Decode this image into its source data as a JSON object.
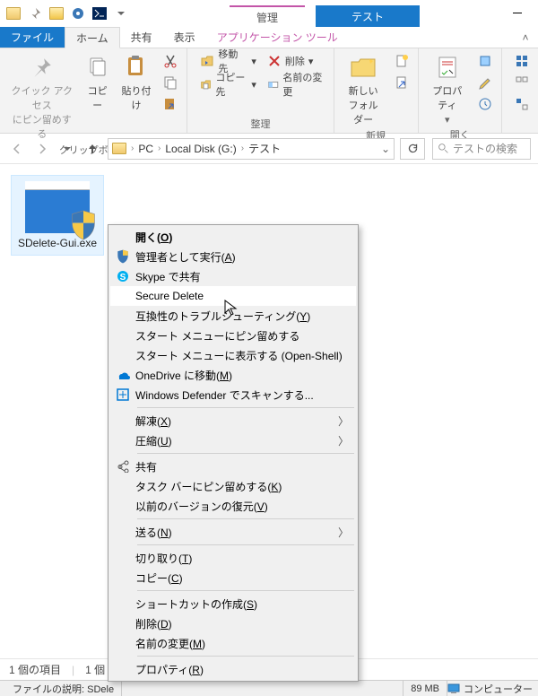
{
  "title_tabs": {
    "manage": "管理",
    "test": "テスト"
  },
  "ribbon_tabs": {
    "file": "ファイル",
    "home": "ホーム",
    "share": "共有",
    "view": "表示",
    "app_tools": "アプリケーション ツール"
  },
  "ribbon": {
    "clipboard": {
      "pin": "クイック アクセス\nにピン留めする",
      "copy": "コピー",
      "paste": "貼り付け",
      "group": "クリップボード"
    },
    "organize": {
      "move_to": "移動先",
      "copy_to": "コピー先",
      "delete": "削除",
      "rename": "名前の変更",
      "group": "整理"
    },
    "new": {
      "new_folder": "新しい\nフォルダー",
      "group": "新規"
    },
    "open": {
      "properties": "プロパティ",
      "group": "開く"
    }
  },
  "breadcrumbs": [
    "PC",
    "Local Disk (G:)",
    "テスト"
  ],
  "search_placeholder": "テストの検索",
  "file": {
    "name": "SDelete-Gui.exe"
  },
  "status": {
    "count": "1 個の項目",
    "selected": "1 個",
    "desc": "ファイルの説明: SDele",
    "size": "89 MB",
    "computer": "コンピューター"
  },
  "ctx": {
    "open": "開く(O)",
    "run_admin": "管理者として実行(A)",
    "skype": "Skype で共有",
    "secure_delete": "Secure Delete",
    "compat": "互換性のトラブルシューティング(Y)",
    "pin_start": "スタート メニューにピン留めする",
    "show_start": "スタート メニューに表示する (Open-Shell)",
    "onedrive": "OneDrive に移動(M)",
    "defender": "Windows Defender でスキャンする...",
    "extract": "解凍(X)",
    "compress": "圧縮(U)",
    "share": "共有",
    "pin_taskbar": "タスク バーにピン留めする(K)",
    "prev_versions": "以前のバージョンの復元(V)",
    "send_to": "送る(N)",
    "cut": "切り取り(T)",
    "copy": "コピー(C)",
    "shortcut": "ショートカットの作成(S)",
    "delete": "削除(D)",
    "rename": "名前の変更(M)",
    "properties": "プロパティ(R)"
  }
}
